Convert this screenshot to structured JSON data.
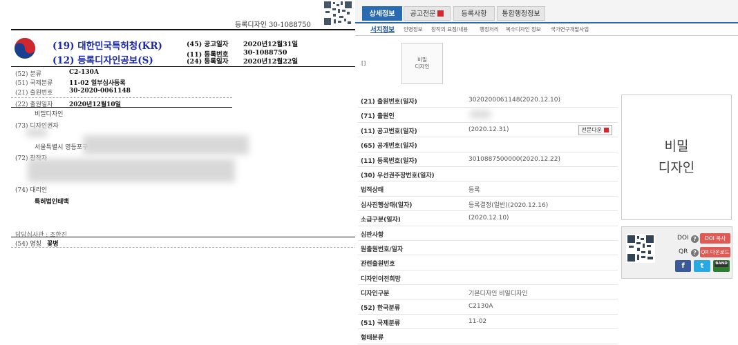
{
  "document": {
    "registration_line": "등록디자인 30-1088750",
    "header_line1": "(19) 대한민국특허청(KR)",
    "header_line2": "(12) 등록디자인공보(S)",
    "meta": [
      {
        "key": "(45) 공고일자",
        "value": "2020년12월31일"
      },
      {
        "key": "(11) 등록번호",
        "value": "30-1088750"
      },
      {
        "key": "(24) 등록일자",
        "value": "2020년12월22일"
      }
    ],
    "bib": [
      {
        "key": "(52) 분류",
        "value": "C2-130A"
      },
      {
        "key": "(51) 국제분류",
        "value": "11-02 일부심사등록"
      },
      {
        "key": "(21) 출원번호",
        "value": "30-2020-0061148"
      },
      {
        "key": "(22) 출원일자",
        "value": "2020년12월10일"
      }
    ],
    "secret_design": "비밀디자인",
    "holder_label": "(73) 디자인권자",
    "holder_address": "서울특별시 영등포구",
    "creator_label": "(72) 창작자",
    "agent_label": "(74) 대리인",
    "agent_name": "특허법인태백",
    "examiner": "담당심사관 : 조한진",
    "title_label": "(54) 명칭",
    "title_value": "꽃병"
  },
  "tabs": [
    {
      "label": "상세정보",
      "active": true,
      "pdf": false
    },
    {
      "label": "공고전문",
      "active": false,
      "pdf": true
    },
    {
      "label": "등록사항",
      "active": false,
      "pdf": false
    },
    {
      "label": "통합행정정보",
      "active": false,
      "pdf": false
    }
  ],
  "subtabs": [
    "서지정보",
    "인명정보",
    "창작의 요점/내용",
    "행정처리",
    "복수디자인 정보",
    "국가연구개발사업"
  ],
  "thumbnail": {
    "bracket": "[]",
    "line1": "비밀",
    "line2": "디자인"
  },
  "info_rows": [
    {
      "label": "(21) 출원번호(일자)",
      "value": "3020200061148(2020.12.10)"
    },
    {
      "label": "(71) 출원인",
      "value": ""
    },
    {
      "label": "(11) 공고번호(일자)",
      "value": "(2020.12.31)",
      "button": "전문다운"
    },
    {
      "label": "(65) 공개번호(일자)",
      "value": ""
    },
    {
      "label": "(11) 등록번호(일자)",
      "value": "3010887500000(2020.12.22)"
    },
    {
      "label": "(30) 우선권주장번호(일자)",
      "value": ""
    },
    {
      "label": "법적상태",
      "value": "등록"
    },
    {
      "label": "심사진행상태(일자)",
      "value": "등록결정(일반)(2020.12.16)"
    },
    {
      "label": "소급구분(일자)",
      "value": "(2020.12.10)"
    },
    {
      "label": "심판사항",
      "value": ""
    },
    {
      "label": "원출원번호/일자",
      "value": ""
    },
    {
      "label": "관련출원번호",
      "value": ""
    },
    {
      "label": "디자인이전희망",
      "value": ""
    },
    {
      "label": "디자인구분",
      "value": "기본디자인 비밀디자인"
    },
    {
      "label": "(52) 한국분류",
      "value": "C2130A"
    },
    {
      "label": "(51) 국제분류",
      "value": "11-02"
    },
    {
      "label": "형태분류",
      "value": ""
    }
  ],
  "secret_box": {
    "line1": "비밀",
    "line2": "디자인"
  },
  "share": {
    "doi_label": "DOI",
    "qr_label": "QR",
    "help": "?",
    "doi_copy": "DOI 복사",
    "qr_download": "QR 다운로드",
    "facebook": "f",
    "twitter": "t",
    "band": "BAND"
  },
  "colors": {
    "tab_active": "#2a6ab0",
    "header_blue": "#1a2aa8",
    "pdf_red": "#d9262d",
    "share_pink": "#e05a55"
  }
}
